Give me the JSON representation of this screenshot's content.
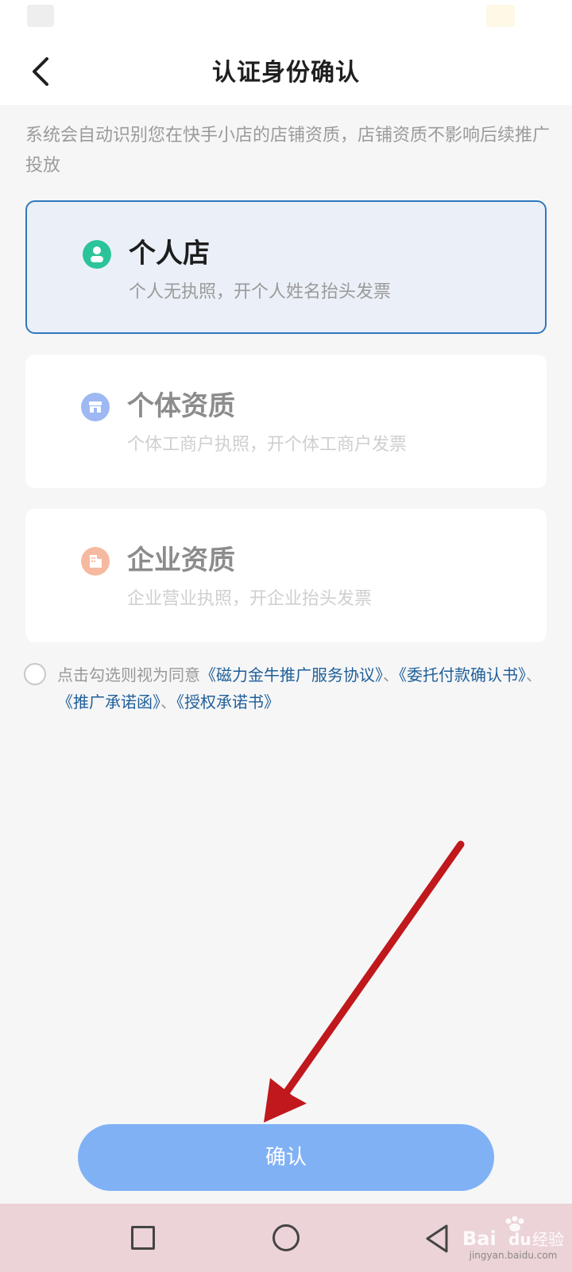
{
  "nav": {
    "title": "认证身份确认"
  },
  "description": "系统会自动识别您在快手小店的店铺资质，店铺资质不影响后续推广投放",
  "options": [
    {
      "title": "个人店",
      "subtitle": "个人无执照，开个人姓名抬头发票",
      "icon": "person-icon",
      "color": "#2bc49a",
      "selected": true
    },
    {
      "title": "个体资质",
      "subtitle": "个体工商户执照，开个体工商户发票",
      "icon": "shop-icon",
      "color": "#9db8f2",
      "selected": false
    },
    {
      "title": "企业资质",
      "subtitle": "企业营业执照，开企业抬头发票",
      "icon": "building-icon",
      "color": "#f6b9a0",
      "selected": false
    }
  ],
  "agreement": {
    "prefix": "点击勾选则视为同意",
    "links": [
      "《磁力金牛推广服务协议》",
      "《委托付款确认书》",
      "《推广承诺函》",
      "《授权承诺书》"
    ],
    "separator": "、"
  },
  "confirm_label": "确认",
  "watermark": {
    "logo": "Bai du 经验",
    "url": "jingyan.baidu.com"
  }
}
